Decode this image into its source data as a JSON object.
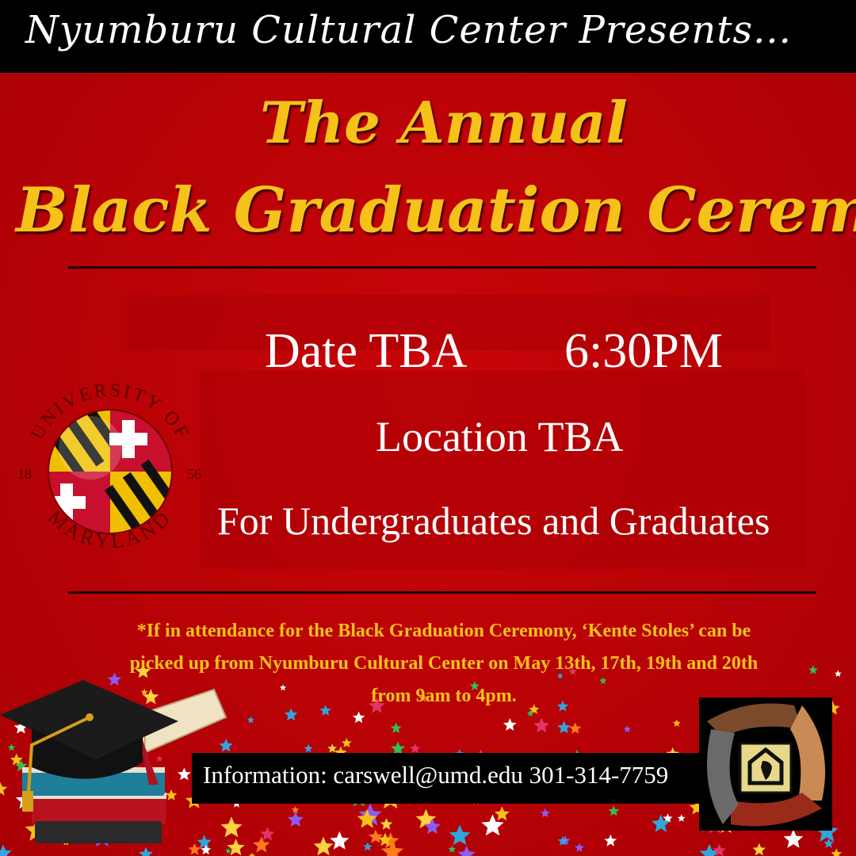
{
  "header": {
    "presents": "Nyumburu Cultural Center Presents..."
  },
  "title": {
    "line1": "The Annual",
    "line2": "Black Graduation Ceremony"
  },
  "event": {
    "date": "Date TBA",
    "time": "6:30PM",
    "location": "Location TBA",
    "audience": "For Undergraduates and Graduates"
  },
  "notice": {
    "line1": "*If in attendance for the Black Graduation Ceremony, ‘Kente Stoles’ can be",
    "line2": "picked up from Nyumburu Cultural Center on May 13th, 17th, 19th and 20th",
    "line3": "from 9am to 4pm."
  },
  "contact": {
    "text": "Information: carswell@umd.edu 301-314-7759"
  },
  "logo": {
    "arc_top": "UNIVERSITY OF",
    "arc_bottom": "MARYLAND",
    "year_left": "18",
    "year_right": "56"
  },
  "colors": {
    "background": "#c20005",
    "title_gold": "#f6c21a",
    "header_bar": "#000000",
    "text_white": "#ffffff"
  },
  "icons": [
    "university-of-maryland-seal",
    "graduation-cap-icon",
    "diploma-scroll-icon",
    "books-icon",
    "nyumburu-hands-logo",
    "confetti-stars"
  ]
}
